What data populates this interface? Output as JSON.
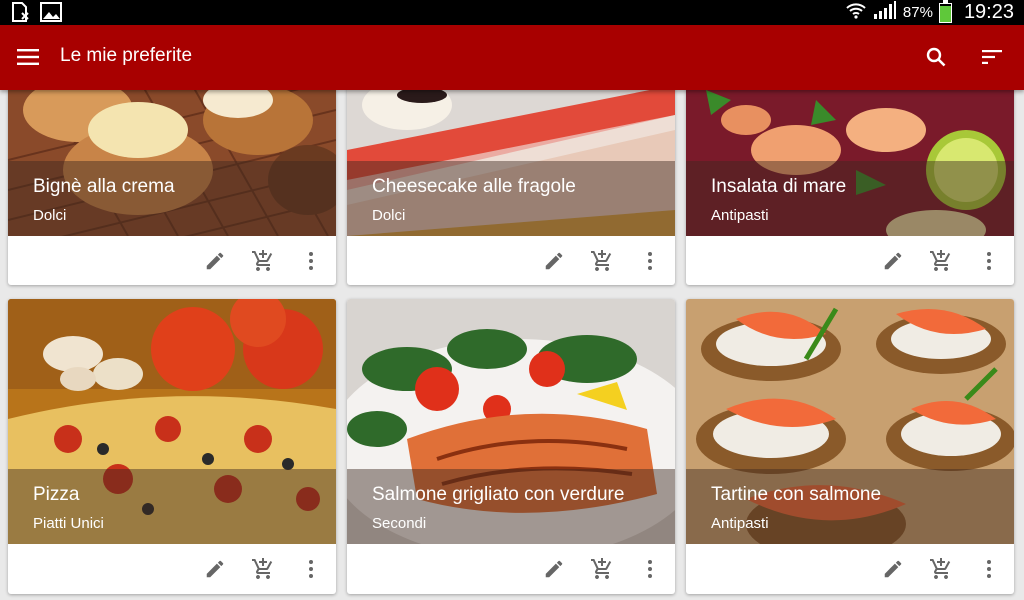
{
  "status_bar": {
    "battery_percent": "87%",
    "battery_level": 0.87,
    "time": "19:23",
    "icons": [
      "sim-card-icon",
      "gallery-icon",
      "wifi-icon",
      "signal-icon",
      "battery-icon"
    ]
  },
  "toolbar": {
    "title": "Le mie preferite",
    "icons": [
      "menu-icon",
      "search-icon",
      "sort-icon"
    ],
    "color": "#a80000"
  },
  "recipes": [
    {
      "name": "Bignè alla crema",
      "category": "Dolci"
    },
    {
      "name": "Cheesecake alle fragole",
      "category": "Dolci"
    },
    {
      "name": "Insalata di mare",
      "category": "Antipasti"
    },
    {
      "name": "Pizza",
      "category": "Piatti Unici"
    },
    {
      "name": "Salmone grigliato con verdure",
      "category": "Secondi"
    },
    {
      "name": "Tartine con salmone",
      "category": "Antipasti"
    }
  ],
  "card_actions": [
    "edit-icon",
    "add-to-cart-icon",
    "more-vert-icon"
  ]
}
